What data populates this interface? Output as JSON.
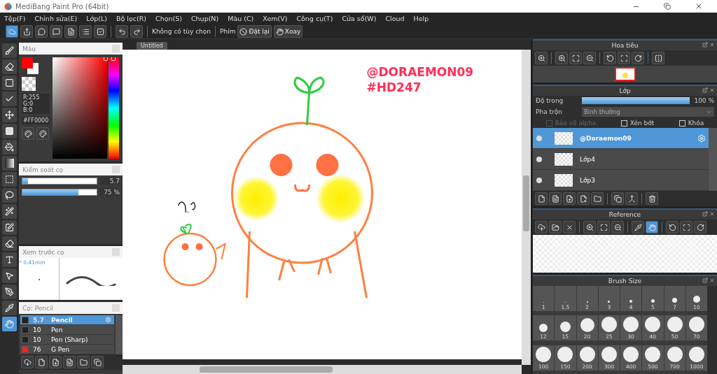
{
  "window": {
    "title": "MediBang Paint Pro (64bit)"
  },
  "menu": [
    "Tệp(F)",
    "Chỉnh sửa(E)",
    "Lớp(L)",
    "Bộ lọc(R)",
    "Chọn(S)",
    "Chụp(N)",
    "Màu (C)",
    "Xem(V)",
    "Công cụ(T)",
    "Cửa sổ(W)",
    "Cloud",
    "Help"
  ],
  "toolbar": {
    "no_options": "Không có tùy chọn",
    "key_label": "Phím",
    "buttons": [
      {
        "kind": "reset",
        "label": "Đặt lại"
      },
      {
        "kind": "rotate",
        "label": "Xoay"
      }
    ]
  },
  "tools": [
    {
      "kind": "brush",
      "selected": false
    },
    {
      "kind": "eraser",
      "selected": false
    },
    {
      "kind": "rect",
      "selected": false
    },
    {
      "kind": "line",
      "selected": false
    },
    {
      "kind": "move",
      "selected": false
    },
    {
      "kind": "fill",
      "selected": false
    },
    {
      "kind": "bucket",
      "selected": false
    },
    {
      "kind": "gradient",
      "selected": false
    },
    {
      "kind": "select",
      "selected": false
    },
    {
      "kind": "lasso",
      "selected": false
    },
    {
      "kind": "wand",
      "selected": false
    },
    {
      "kind": "selectpen",
      "selected": false
    },
    {
      "kind": "selecteraser",
      "selected": false
    },
    {
      "kind": "text",
      "selected": false
    },
    {
      "kind": "pointer",
      "selected": false
    },
    {
      "kind": "pen",
      "selected": false
    },
    {
      "kind": "dropper",
      "selected": false
    },
    {
      "kind": "hand",
      "selected": true
    }
  ],
  "color_panel": {
    "title": "Màu",
    "rgb": [
      "R:255",
      "G:0",
      "B:0"
    ],
    "hex": "#FF0000"
  },
  "brush_control": {
    "title": "Kiểm soát cọ",
    "sliders": [
      {
        "level": 0.08,
        "reading": "5.7"
      },
      {
        "level": 0.75,
        "reading": "75 %"
      }
    ]
  },
  "brush_preview": {
    "title": "Xem trước cọ",
    "size": "* 0.41mm"
  },
  "brush_list": {
    "title": "Cọ: Pencil",
    "items": [
      {
        "size": "5.7",
        "name": "Pencil",
        "selected": true,
        "color": "#222222"
      },
      {
        "size": "10",
        "name": "Pen",
        "selected": false,
        "color": "#222222"
      },
      {
        "size": "10",
        "name": "Pen (Sharp)",
        "selected": false,
        "color": "#222222"
      },
      {
        "size": "76",
        "name": "G Pen",
        "selected": false,
        "color": "#ff2020"
      }
    ]
  },
  "canvas": {
    "tab": "Untitled",
    "lines": [
      "@DORAEMON09",
      "#HD247"
    ]
  },
  "navigator": {
    "title": "Hoa tiêu"
  },
  "layers": {
    "title": "Lớp",
    "opacity_label": "Độ trong",
    "opacity": {
      "level": 1,
      "reading": "100 %"
    },
    "blend_label": "Pha trộn",
    "blend": "Bình thường",
    "options": [
      {
        "label": "Bảo vệ alpha",
        "checked": false,
        "disabled": true
      },
      {
        "label": "Xén bớt",
        "checked": false,
        "disabled": false
      },
      {
        "label": "Khóa",
        "checked": false,
        "disabled": false
      }
    ],
    "items": [
      {
        "name": "@Doraemon09",
        "selected": true
      },
      {
        "name": "Lớp4",
        "selected": false
      },
      {
        "name": "Lớp3",
        "selected": false
      }
    ]
  },
  "reference": {
    "title": "Reference",
    "hand_selected": true
  },
  "brush_size": {
    "title": "Brush Size",
    "sizes": [
      "1",
      "1.5",
      "2",
      "3",
      "4",
      "5",
      "7",
      "10",
      "12",
      "15",
      "20",
      "25",
      "30",
      "40",
      "50",
      "70",
      "100",
      "150",
      "200",
      "300",
      "400",
      "500",
      "700",
      "1000"
    ]
  }
}
